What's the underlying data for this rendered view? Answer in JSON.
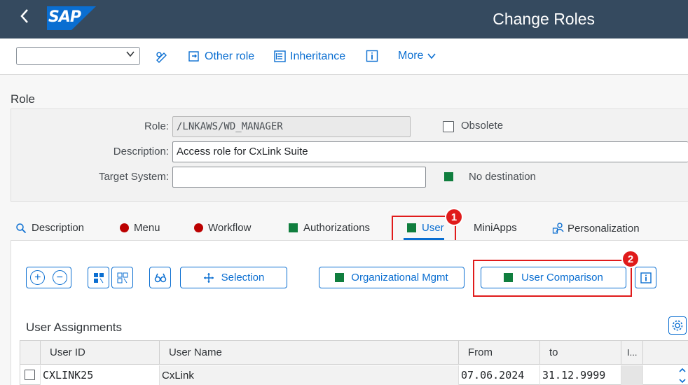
{
  "shell": {
    "title": "Change Roles",
    "logo_text": "SAP",
    "back_icon": "chevron-left-icon"
  },
  "toolbar": {
    "select_value": "",
    "other_role": "Other role",
    "inheritance": "Inheritance",
    "more": "More"
  },
  "role": {
    "section_title": "Role",
    "role_label": "Role:",
    "role_value": "/LNKAWS/WD_MANAGER",
    "obsolete_label": "Obsolete",
    "description_label": "Description:",
    "description_value": "Access role for CxLink Suite",
    "target_label": "Target System:",
    "target_value": "",
    "destination_status": "No destination"
  },
  "tabs": [
    "Description",
    "Menu",
    "Workflow",
    "Authorizations",
    "User",
    "MiniApps",
    "Personalization"
  ],
  "user_tab": {
    "selection_label": "Selection",
    "org_mgmt_label": "Organizational Mgmt",
    "user_comparison_label": "User Comparison",
    "assignments_title": "User Assignments",
    "callout_1": "1",
    "callout_2": "2"
  },
  "table": {
    "columns": [
      "User ID",
      "User Name",
      "From",
      "to",
      "I..."
    ],
    "rows": [
      {
        "user_id": "CXLINK25",
        "user_name": "CxLink",
        "from": "07.06.2024",
        "to": "31.12.9999"
      }
    ]
  },
  "colors": {
    "shell": "#354a5f",
    "accent": "#0a6ed1",
    "status_green": "#107e3e",
    "status_red": "#bb0000",
    "highlight": "#e01b1b"
  }
}
